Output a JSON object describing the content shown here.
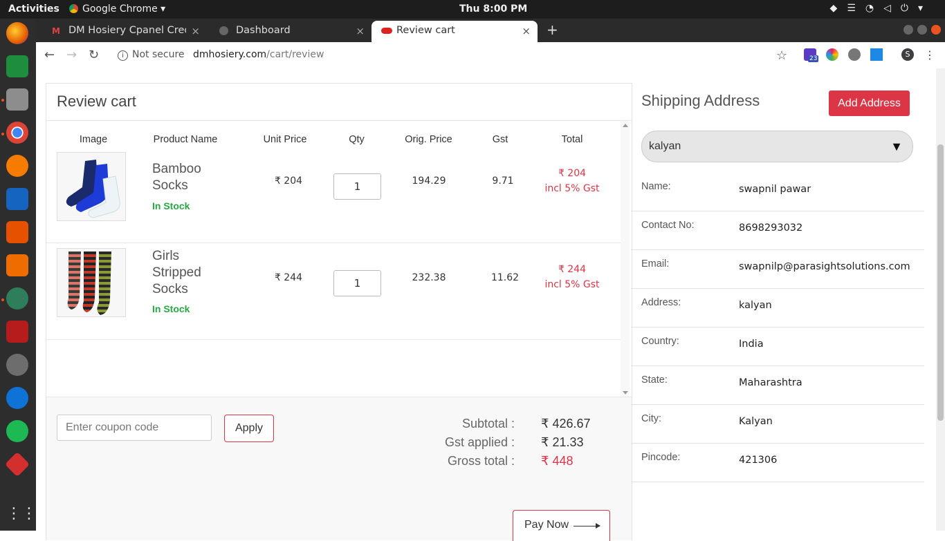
{
  "topbar": {
    "activities": "Activities",
    "app_name": "Google Chrome ▾",
    "clock": "Thu  8:00 PM"
  },
  "tabs": [
    {
      "label": "DM Hosiery Cpanel Crede",
      "close": "×"
    },
    {
      "label": "Dashboard",
      "close": "×"
    },
    {
      "label": "Review cart",
      "close": "×"
    }
  ],
  "addressbar": {
    "security": "Not secure",
    "domain": "dmhosiery.com",
    "path": "/cart/review"
  },
  "extensions": {
    "badge": "23",
    "profile": "S"
  },
  "cart": {
    "title": "Review cart",
    "headers": [
      "Image",
      "Product Name",
      "Unit Price",
      "Qty",
      "Orig. Price",
      "Gst",
      "Total"
    ],
    "items": [
      {
        "name": "Bamboo Socks",
        "stock": "In Stock",
        "unit_price": "₹ 204",
        "qty": "1",
        "orig_price": "194.29",
        "gst": "9.71",
        "total": "₹ 204",
        "total_note": "incl 5% Gst"
      },
      {
        "name": "Girls Stripped Socks",
        "stock": "In Stock",
        "unit_price": "₹ 244",
        "qty": "1",
        "orig_price": "232.38",
        "gst": "11.62",
        "total": "₹ 244",
        "total_note": "incl 5% Gst"
      }
    ]
  },
  "summary": {
    "coupon_placeholder": "Enter coupon code",
    "apply_label": "Apply",
    "subtotal_label": "Subtotal :",
    "subtotal_value": "₹ 426.67",
    "gst_label": "Gst applied :",
    "gst_value": "₹ 21.33",
    "gross_label": "Gross total :",
    "gross_value": "₹ 448",
    "pay_label": "Pay Now"
  },
  "shipping": {
    "title": "Shipping Address",
    "add_label": "Add Address",
    "selected": "kalyan",
    "fields": [
      {
        "label": "Name:",
        "value": "swapnil pawar"
      },
      {
        "label": "Contact No:",
        "value": "8698293032"
      },
      {
        "label": "Email:",
        "value": "swapnilp@parasightsolutions.com"
      },
      {
        "label": "Address:",
        "value": "kalyan"
      },
      {
        "label": "Country:",
        "value": "India"
      },
      {
        "label": "State:",
        "value": "Maharashtra"
      },
      {
        "label": "City:",
        "value": "Kalyan"
      },
      {
        "label": "Pincode:",
        "value": "421306"
      }
    ]
  },
  "colors": {
    "accent": "#dc3545",
    "in_stock": "#28a745"
  }
}
